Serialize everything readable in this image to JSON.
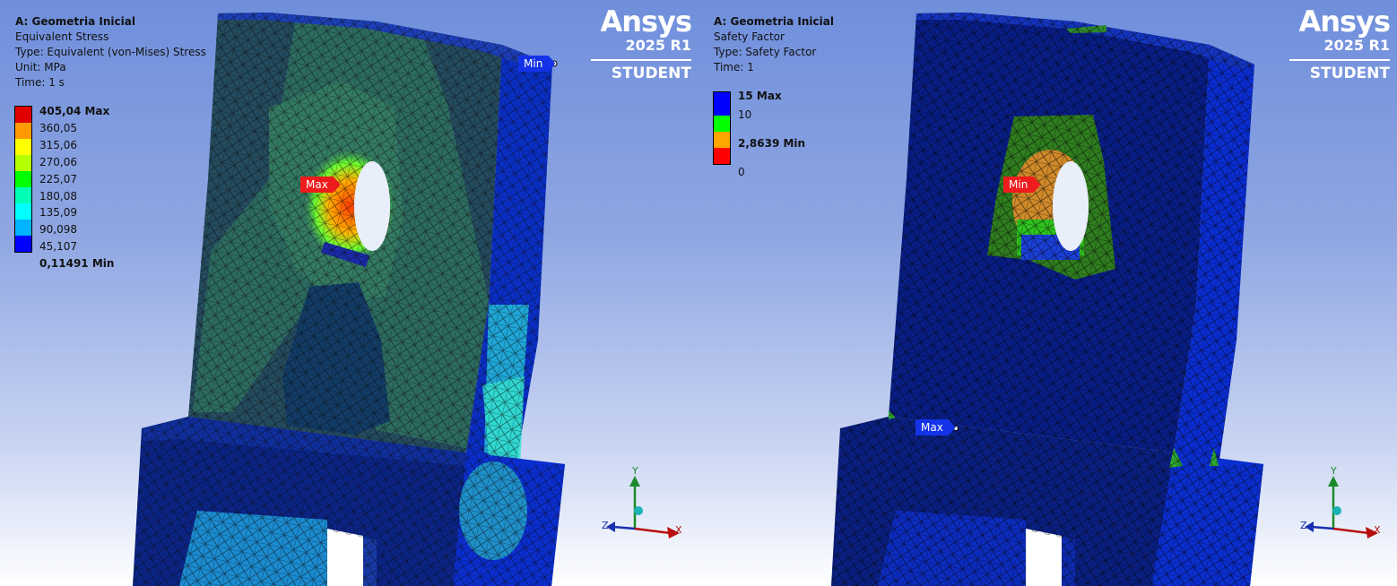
{
  "left": {
    "info": {
      "title": "A: Geometria Inicial",
      "line1": "Equivalent Stress",
      "line2": "Type: Equivalent (von-Mises) Stress",
      "line3": "Unit: MPa",
      "line4": "Time: 1 s"
    },
    "legend": {
      "labels": [
        "405,04 Max",
        "360,05",
        "315,06",
        "270,06",
        "225,07",
        "180,08",
        "135,09",
        "90,098",
        "45,107",
        "0,11491 Min"
      ],
      "colors": [
        "#e00000",
        "#ff9a00",
        "#ffff00",
        "#b4ff00",
        "#00ff00",
        "#00ffb4",
        "#00ffff",
        "#00b4ff",
        "#0000ff"
      ]
    },
    "tags": {
      "max": "Max",
      "min": "Min"
    }
  },
  "right": {
    "info": {
      "title": "A: Geometria Inicial",
      "line1": "Safety Factor",
      "line2": "Type: Safety Factor",
      "line3": "Time: 1"
    },
    "legend": {
      "labels": [
        "15 Max",
        "10",
        "2,8639 Min",
        "0"
      ],
      "colors": [
        "#0000ff",
        "#00ff00",
        "#ffa500",
        "#ff0000"
      ]
    },
    "tags": {
      "max": "Max",
      "min": "Min"
    }
  },
  "brand": {
    "name": "Ansys",
    "version": "2025 R1",
    "edition": "STUDENT"
  },
  "triad": {
    "x": "X",
    "y": "Y",
    "z": "Z"
  }
}
